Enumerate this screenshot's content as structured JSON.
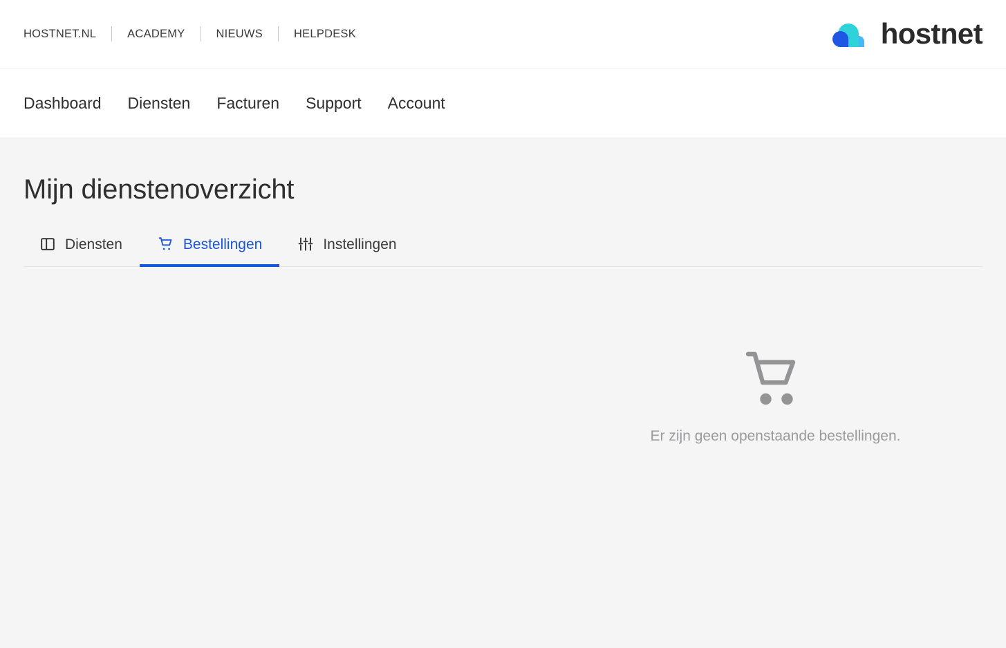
{
  "utility_bar": {
    "links": [
      {
        "label": "HOSTNET.NL",
        "name": "utility-link-hostnet"
      },
      {
        "label": "ACADEMY",
        "name": "utility-link-academy"
      },
      {
        "label": "NIEUWS",
        "name": "utility-link-nieuws"
      },
      {
        "label": "HELPDESK",
        "name": "utility-link-helpdesk"
      }
    ],
    "brand": {
      "wordmark": "hostnet",
      "logo_icon": "cloud-logo-icon",
      "colors": {
        "cloud_teal": "#2ed3d9",
        "cloud_circle_blue": "#1f56e3",
        "cloud_light_blue": "#45b9f5",
        "wordmark": "#2b2b2b"
      }
    }
  },
  "main_nav": {
    "items": [
      {
        "label": "Dashboard",
        "name": "nav-item-dashboard"
      },
      {
        "label": "Diensten",
        "name": "nav-item-diensten"
      },
      {
        "label": "Facturen",
        "name": "nav-item-facturen"
      },
      {
        "label": "Support",
        "name": "nav-item-support"
      },
      {
        "label": "Account",
        "name": "nav-item-account"
      }
    ]
  },
  "page": {
    "title": "Mijn dienstenoverzicht",
    "accent_color": "#1a56db",
    "background_color": "#f5f5f6"
  },
  "tabs": [
    {
      "label": "Diensten",
      "icon": "panel-layout-icon",
      "active": false,
      "name": "tab-diensten"
    },
    {
      "label": "Bestellingen",
      "icon": "shopping-cart-icon",
      "active": true,
      "name": "tab-bestellingen"
    },
    {
      "label": "Instellingen",
      "icon": "sliders-icon",
      "active": false,
      "name": "tab-instellingen"
    }
  ],
  "empty_state": {
    "icon": "shopping-cart-icon",
    "icon_color": "#949497",
    "message": "Er zijn geen openstaande bestellingen."
  }
}
